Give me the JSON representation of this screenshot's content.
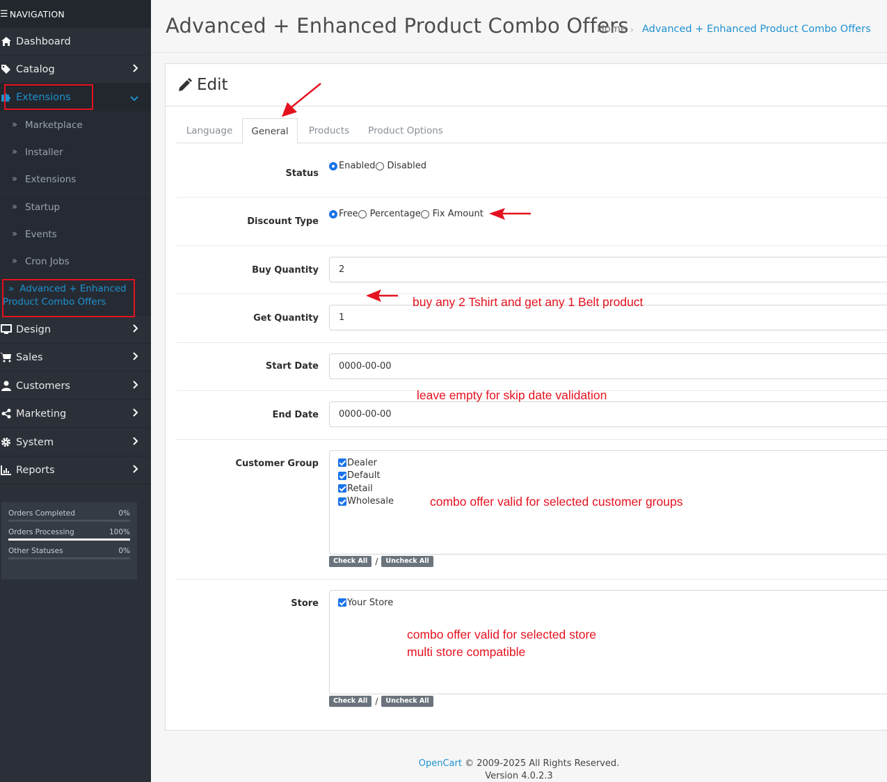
{
  "sidebar": {
    "heading": "NAVIGATION",
    "menu": [
      {
        "label": "Dashboard",
        "icon": "home-icon"
      },
      {
        "label": "Catalog",
        "icon": "tag-icon"
      },
      {
        "label": "Extensions",
        "icon": "puzzle-icon"
      },
      {
        "label": "Design",
        "icon": "monitor-icon"
      },
      {
        "label": "Sales",
        "icon": "cart-icon"
      },
      {
        "label": "Customers",
        "icon": "user-icon"
      },
      {
        "label": "Marketing",
        "icon": "share-icon"
      },
      {
        "label": "System",
        "icon": "gear-icon"
      },
      {
        "label": "Reports",
        "icon": "chart-icon"
      }
    ],
    "extensions_sub": [
      "Marketplace",
      "Installer",
      "Extensions",
      "Startup",
      "Events",
      "Cron Jobs"
    ],
    "active_sub_line1": "Advanced + Enhanced",
    "active_sub_line2": "Product Combo Offers",
    "stats": [
      {
        "label": "Orders Completed",
        "value": "0%",
        "fraction": 0
      },
      {
        "label": "Orders Processing",
        "value": "100%",
        "fraction": 1
      },
      {
        "label": "Other Statuses",
        "value": "0%",
        "fraction": 0
      }
    ]
  },
  "header": {
    "title": "Advanced + Enhanced Product Combo Offers",
    "breadcrumb_home": "Home",
    "breadcrumb_current": "Advanced + Enhanced Product Combo Offers"
  },
  "card": {
    "title": "Edit",
    "tabs": [
      "Language",
      "General",
      "Products",
      "Product Options"
    ]
  },
  "form": {
    "status": {
      "label": "Status",
      "options": [
        "Enabled",
        "Disabled"
      ],
      "selected": "Enabled"
    },
    "discount_type": {
      "label": "Discount Type",
      "options": [
        "Free",
        "Percentage",
        "Fix Amount"
      ],
      "selected": "Free"
    },
    "buy_quantity": {
      "label": "Buy Quantity",
      "value": "2"
    },
    "get_quantity": {
      "label": "Get Quantity",
      "value": "1"
    },
    "start_date": {
      "label": "Start Date",
      "value": "0000-00-00"
    },
    "end_date": {
      "label": "End Date",
      "value": "0000-00-00"
    },
    "customer_group": {
      "label": "Customer Group",
      "options": [
        "Dealer",
        "Default",
        "Retail",
        "Wholesale"
      ]
    },
    "store": {
      "label": "Store",
      "options": [
        "Your Store"
      ]
    },
    "check_all": "Check All",
    "uncheck_all": "Uncheck All",
    "slash": "/"
  },
  "annotations": {
    "quantity_note": "buy any 2 Tshirt and get any 1 Belt product",
    "date_note": "leave empty for skip date validation",
    "group_note": "combo offer valid for selected customer groups",
    "store_note_1": "combo offer valid for selected store",
    "store_note_2": "multi store compatible",
    "color": "#e4121f"
  },
  "footer": {
    "brand": "OpenCart",
    "copyright": "© 2009-2025 All Rights Reserved.",
    "version": "Version 4.0.2.3"
  }
}
